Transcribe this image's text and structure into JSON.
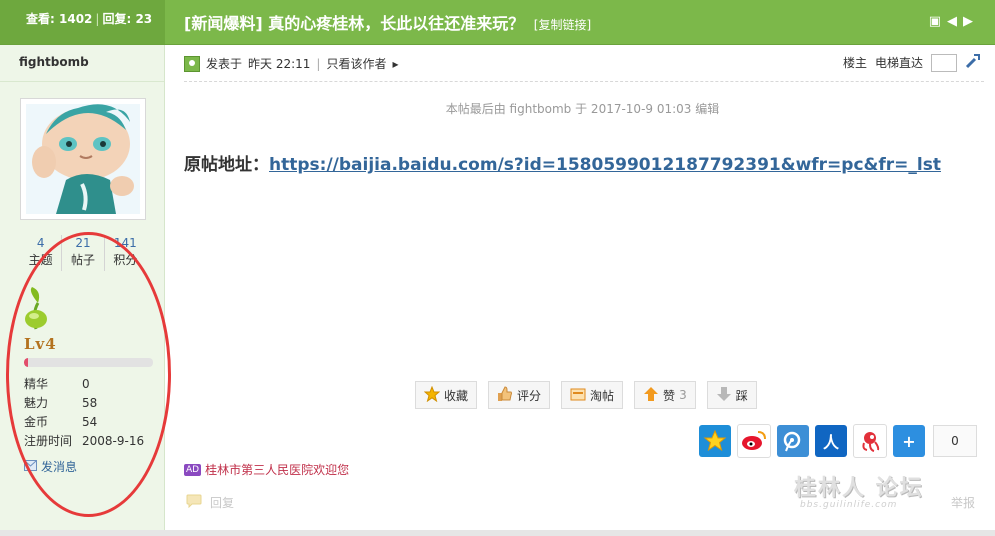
{
  "thread": {
    "views_label": "查看:",
    "views": "1402",
    "replies_label": "回复:",
    "replies": "23",
    "title": "[新闻爆料] 真的心疼桂林，长此以往还准来玩？",
    "copy_link": "[复制链接]"
  },
  "author": {
    "name": "fightbomb",
    "stats": [
      {
        "value": "4",
        "label": "主题"
      },
      {
        "value": "21",
        "label": "帖子"
      },
      {
        "value": "141",
        "label": "积分"
      }
    ],
    "level": "Lv4",
    "level_progress_fraction": 0.03,
    "info": [
      {
        "key": "精华",
        "value": "0"
      },
      {
        "key": "魅力",
        "value": "58"
      },
      {
        "key": "金币",
        "value": "54"
      },
      {
        "key": "注册时间",
        "value": "2008-9-16"
      }
    ],
    "message": "发消息"
  },
  "post": {
    "posted_label": "发表于",
    "posted_time": "昨天 22:11",
    "author_only": "只看该作者",
    "floor": "楼主",
    "jump_label": "电梯直达",
    "edit_note": "本帖最后由 fightbomb 于 2017-10-9 01:03 编辑",
    "content_label": "原帖地址：",
    "content_link": "https://baijia.baidu.com/s?id=1580599012187792391&wfr=pc&fr=_lst"
  },
  "actions": [
    {
      "name": "favorite",
      "label": "收藏",
      "icon": "star-icon",
      "count": ""
    },
    {
      "name": "rate",
      "label": "评分",
      "icon": "thumb-icon",
      "count": ""
    },
    {
      "name": "collect",
      "label": "淘帖",
      "icon": "tray-icon",
      "count": ""
    },
    {
      "name": "like",
      "label": "赞",
      "icon": "up-arrow-icon",
      "count": "3"
    },
    {
      "name": "dislike",
      "label": "踩",
      "icon": "down-arrow-icon",
      "count": ""
    }
  ],
  "share": {
    "count": "0",
    "icons": [
      "qzone-icon",
      "weibo-icon",
      "tencent-weibo-icon",
      "renren-icon",
      "tencent-icon",
      "more-share-icon"
    ]
  },
  "ad_text": "桂林市第三人民医院欢迎您",
  "ad_tag": "AD",
  "reply_label": "回复",
  "report_label": "举报",
  "watermark": "桂林人 论坛",
  "watermark_url": "bbs.guilinlife.com",
  "colors": {
    "topbar": "#7cb84a",
    "sidebar": "#eef6e8",
    "link": "#336699",
    "highlight_ring": "#e63a3a"
  }
}
